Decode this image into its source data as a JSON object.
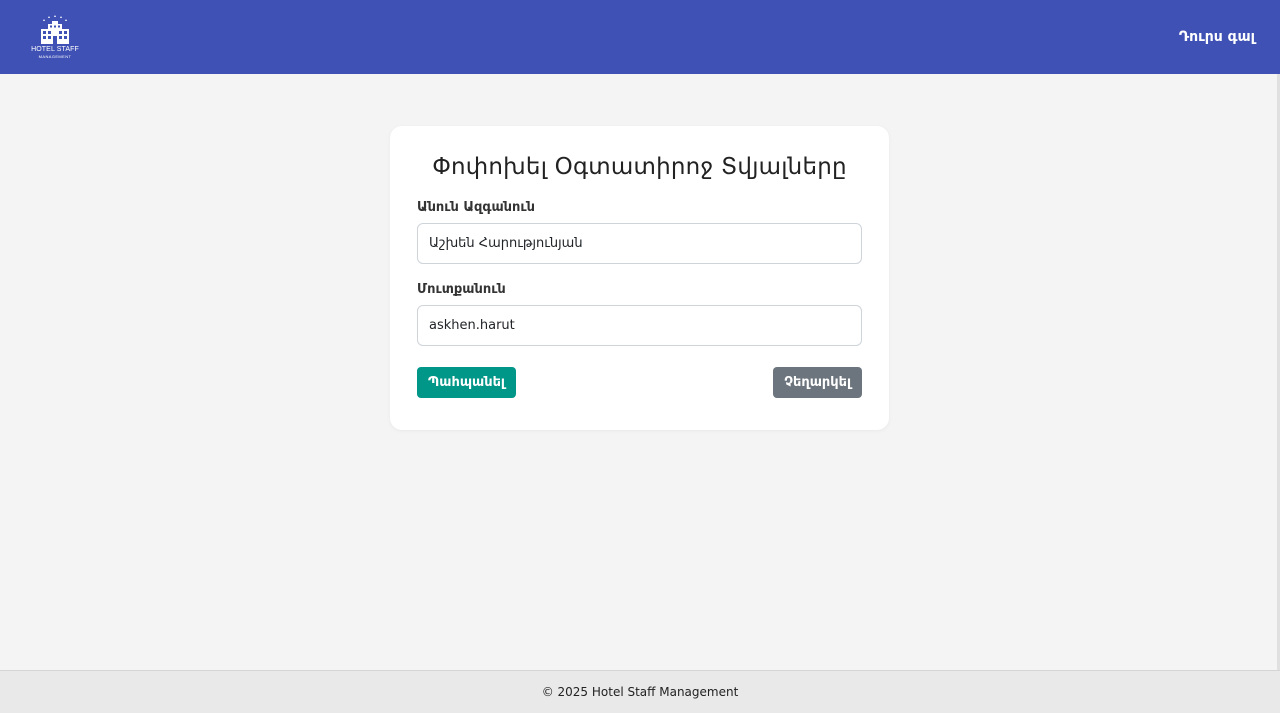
{
  "header": {
    "logo": {
      "icon": "hotel-building-icon",
      "line1": "HOTEL STAFF",
      "line2": "MANAGEMENT"
    },
    "logout_label": "Դուրս գալ"
  },
  "form": {
    "title": "Փոփոխել Օգտատիրոջ Տվյալները",
    "full_name_label": "Անուն Ազգանուն",
    "full_name_value": "Աշխեն Հարությունյան",
    "username_label": "Մուտքանուն",
    "username_value": "askhen.harut",
    "save_label": "Պահպանել",
    "cancel_label": "Չեղարկել"
  },
  "footer": {
    "text": "© 2025 Hotel Staff Management"
  },
  "colors": {
    "navbar": "#3f51b5",
    "save_button": "#009688",
    "cancel_button": "#6c757d",
    "background": "#f4f4f4"
  }
}
